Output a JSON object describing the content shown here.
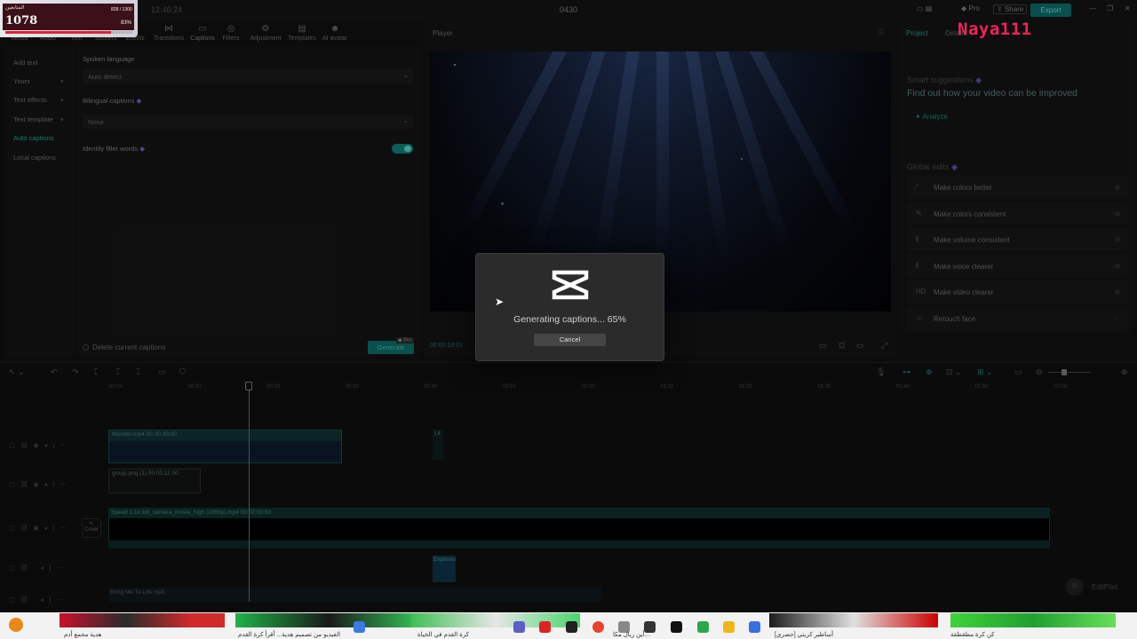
{
  "window": {
    "title": "0430",
    "time": "12:46:24"
  },
  "topbar": {
    "pro_label": "Pro",
    "share_label": "Share",
    "export_label": "Export"
  },
  "overlay": {
    "label": "المتابعين",
    "count": "1078",
    "fraction": "828 / 1300",
    "percent": "83%",
    "progress": 0.83,
    "name_tag": "Naya111"
  },
  "toolbar": {
    "tabs": [
      {
        "label": "Media",
        "icon": "media-icon"
      },
      {
        "label": "Audio",
        "icon": "audio-icon"
      },
      {
        "label": "Text",
        "icon": "text-icon"
      },
      {
        "label": "Stickers",
        "icon": "stickers-icon"
      },
      {
        "label": "Effects",
        "icon": "effects-icon"
      },
      {
        "label": "Transitions",
        "icon": "transitions-icon"
      },
      {
        "label": "Captions",
        "icon": "captions-icon"
      },
      {
        "label": "Filters",
        "icon": "filters-icon"
      },
      {
        "label": "Adjustment",
        "icon": "adjustment-icon"
      },
      {
        "label": "Templates",
        "icon": "templates-icon"
      },
      {
        "label": "AI avatar",
        "icon": "ai-avatar-icon"
      }
    ]
  },
  "left_panel": {
    "items": [
      {
        "label": "Add text"
      },
      {
        "label": "Yours"
      },
      {
        "label": "Text effects"
      },
      {
        "label": "Text template"
      },
      {
        "label": "Auto captions",
        "active": true
      },
      {
        "label": "Local captions"
      }
    ]
  },
  "captions": {
    "spoken_language_label": "Spoken language",
    "spoken_language_value": "Auto detect",
    "bilingual_label": "Bilingual captions",
    "bilingual_value": "None",
    "filler_label": "Identify filler words",
    "filler_enabled": true,
    "delete_label": "Delete current captions",
    "generate_label": "Generate",
    "pro_tag": "Pro"
  },
  "player": {
    "label": "Player",
    "timecode": "00:00:18:01"
  },
  "right_panel": {
    "tabs": [
      {
        "label": "Project"
      },
      {
        "label": "Details"
      }
    ],
    "suggestions_title": "Smart suggestions",
    "suggestions_text": "Find out how your video can be improved",
    "analyze_label": "Analyze",
    "global_edits_title": "Global edits",
    "global_edits": [
      {
        "label": "Make colors better",
        "icon": "wand-icon"
      },
      {
        "label": "Make colors consistent",
        "icon": "brush-icon"
      },
      {
        "label": "Make volume consistent",
        "icon": "volume-icon"
      },
      {
        "label": "Make voice clearer",
        "icon": "voice-icon"
      },
      {
        "label": "Make video clearer",
        "icon": "hd-icon",
        "icon_text": "HD"
      },
      {
        "label": "Retouch face",
        "icon": "face-icon"
      }
    ]
  },
  "timeline": {
    "ticks": [
      "00:00",
      "00:10",
      "00:20",
      "00:30",
      "00:40",
      "00:50",
      "01:00",
      "01:10",
      "01:20",
      "01:30",
      "01:40",
      "01:50",
      "02:00"
    ],
    "clips": {
      "wonder": "Wonder.mp4   00:00:30:00",
      "group": "group.png  (1)  00:00:11:00",
      "speed": "Speed 1.1x   lofi_camera_movie_high (1080p).mp4   00:02:00:00",
      "explosio": "Explosio",
      "bring": "Bring Me To Life.mp3",
      "small": "Lit"
    },
    "cover_label": "Cover",
    "editpilot_label": "EditPilot"
  },
  "modal": {
    "message": "Generating captions... 65%",
    "progress": 0.65,
    "cancel_label": "Cancel"
  },
  "taskbar": {
    "captions": [
      "هدية مجمع أدم",
      "الفيديو من تصميم هدية... أقرأ كرة القدم",
      "كرة القدم في الخياة",
      "أين ريال مكا…",
      "[حصري] أساطير كريتي",
      "كن كرة مطقطقة"
    ]
  }
}
